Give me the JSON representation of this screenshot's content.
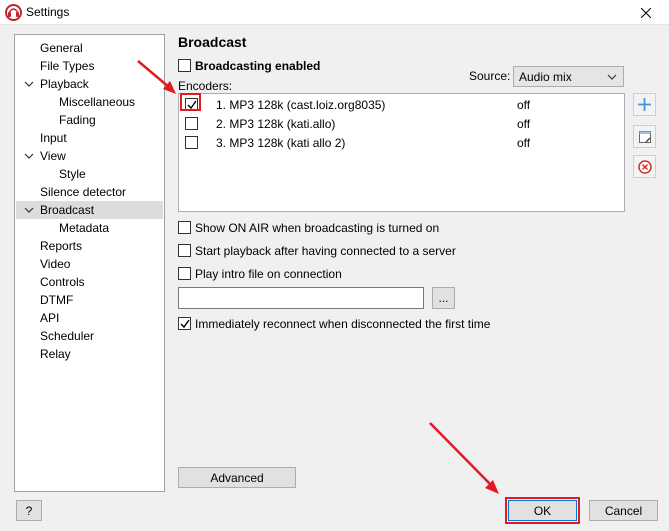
{
  "window": {
    "title": "Settings"
  },
  "sidebar": {
    "items": [
      {
        "label": "General",
        "indent": 0
      },
      {
        "label": "File Types",
        "indent": 0
      },
      {
        "label": "Playback",
        "indent": 0,
        "expanded": true
      },
      {
        "label": "Miscellaneous",
        "indent": 1
      },
      {
        "label": "Fading",
        "indent": 1
      },
      {
        "label": "Input",
        "indent": 0
      },
      {
        "label": "View",
        "indent": 0,
        "expanded": true
      },
      {
        "label": "Style",
        "indent": 1
      },
      {
        "label": "Silence detector",
        "indent": 0
      },
      {
        "label": "Broadcast",
        "indent": 0,
        "expanded": true,
        "selected": true
      },
      {
        "label": "Metadata",
        "indent": 1
      },
      {
        "label": "Reports",
        "indent": 0
      },
      {
        "label": "Video",
        "indent": 0
      },
      {
        "label": "Controls",
        "indent": 0
      },
      {
        "label": "DTMF",
        "indent": 0
      },
      {
        "label": "API",
        "indent": 0
      },
      {
        "label": "Scheduler",
        "indent": 0
      },
      {
        "label": "Relay",
        "indent": 0
      }
    ]
  },
  "broadcast": {
    "title": "Broadcast",
    "enabled_label": "Broadcasting enabled",
    "enabled_checked": false,
    "source_label": "Source:",
    "source_value": "Audio mix",
    "encoders_label": "Encoders:",
    "encoders": [
      {
        "name": "1. MP3 128k (cast.loiz.org8035)",
        "status": "off",
        "checked": true
      },
      {
        "name": "2. MP3 128k (kati.allo)",
        "status": "off",
        "checked": false
      },
      {
        "name": "3. MP3 128k (kati allo 2)",
        "status": "off",
        "checked": false
      }
    ],
    "options": [
      {
        "label": "Show ON AIR when broadcasting is turned on",
        "checked": false
      },
      {
        "label": "Start playback after having connected to a server",
        "checked": false
      },
      {
        "label": "Play intro file on connection",
        "checked": false
      }
    ],
    "intro_file_value": "",
    "browse_label": "...",
    "reconnect_label": "Immediately reconnect when disconnected the first time",
    "reconnect_checked": true,
    "advanced_label": "Advanced"
  },
  "footer": {
    "help_label": "?",
    "ok_label": "OK",
    "cancel_label": "Cancel"
  },
  "colors": {
    "annotation": "#e01b24",
    "accent": "#0078d7",
    "remove": "#d0312d"
  },
  "icons": {
    "add": "plus-icon",
    "edit": "edit-icon",
    "remove": "remove-icon",
    "close": "close-icon"
  }
}
